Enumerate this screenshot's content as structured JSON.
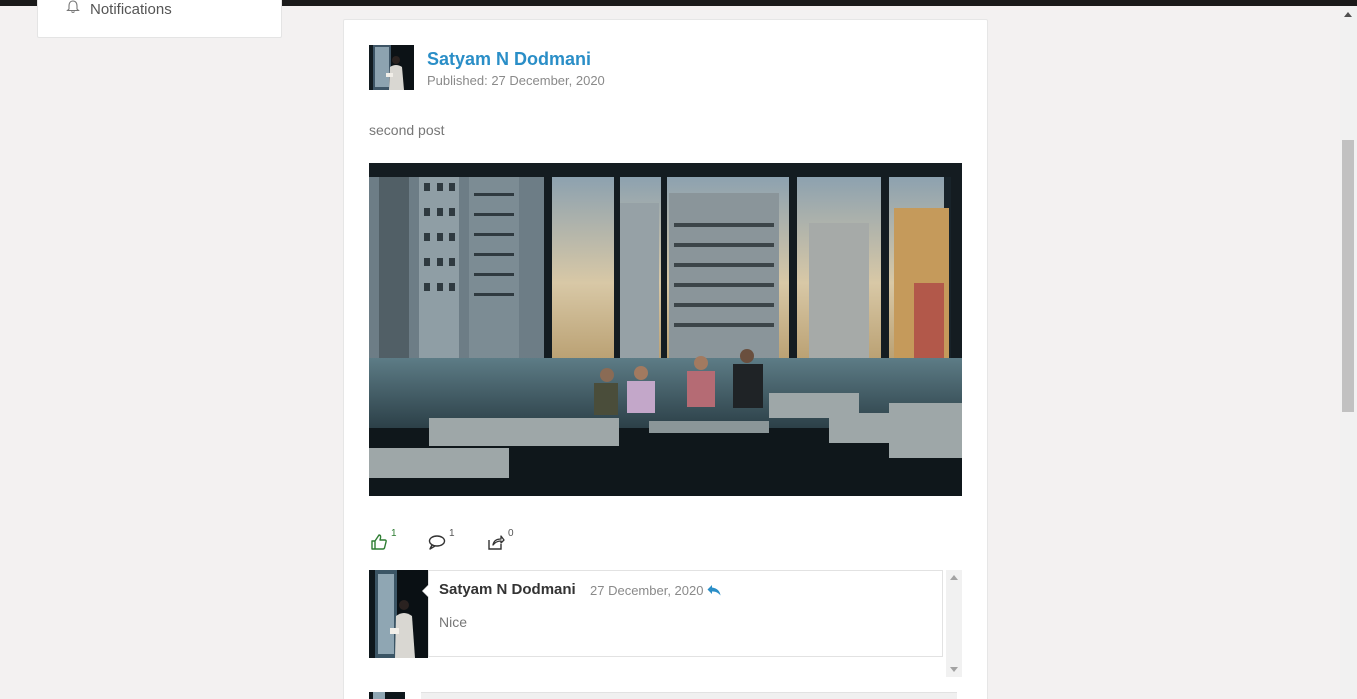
{
  "sidebar": {
    "items": [
      {
        "label": "Notifications",
        "icon": "bell-icon"
      }
    ]
  },
  "post": {
    "author": "Satyam N Dodmani",
    "published": "Published: 27 December, 2020",
    "text": "second post",
    "image_alt": "People sitting on sofas in a high-rise lounge overlooking city buildings",
    "actions": {
      "likes": "1",
      "comments": "1",
      "shares": "0"
    }
  },
  "comments": [
    {
      "author": "Satyam N Dodmani",
      "date": "27 December, 2020",
      "text": "Nice"
    }
  ],
  "colors": {
    "accent": "#2a8ec7",
    "like": "#2e7d32",
    "background": "#f3f1f1"
  }
}
